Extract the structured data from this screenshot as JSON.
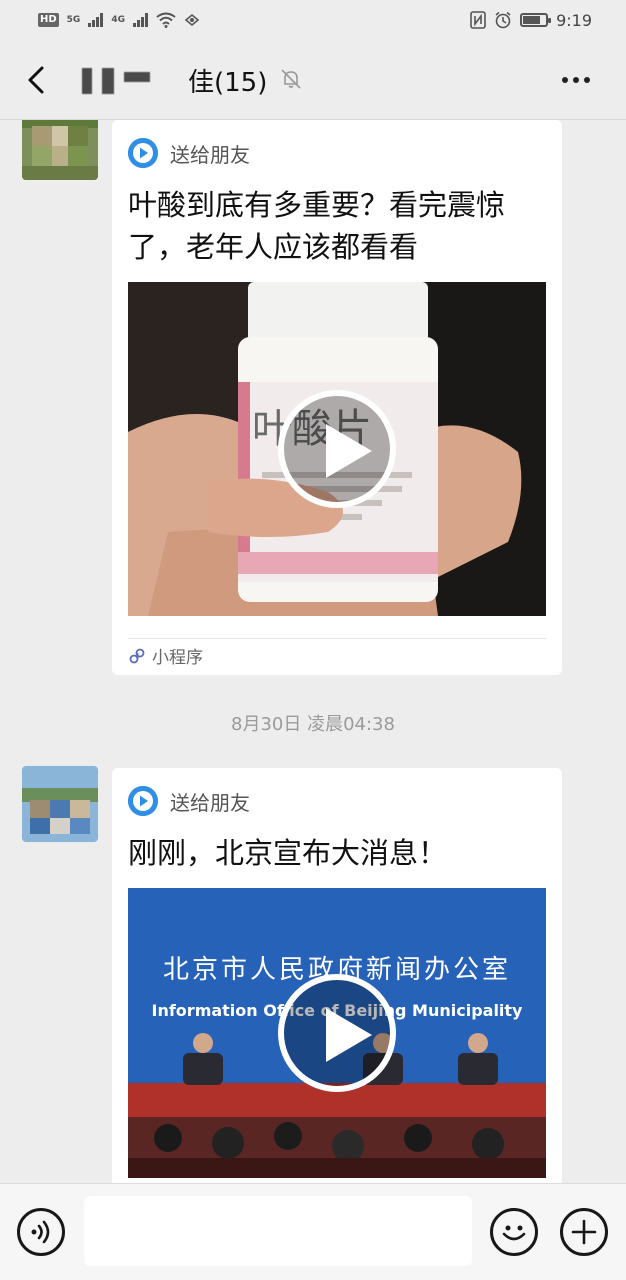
{
  "status_bar": {
    "network_badge": "HD",
    "signal_1": "5G",
    "signal_2": "4G",
    "time": "9:19"
  },
  "header": {
    "title": "佳(15)"
  },
  "messages": [
    {
      "source": "送给朋友",
      "title": "叶酸到底有多重要？看完震惊了，老年人应该都看看",
      "footer": "小程序",
      "thumbnail_label": "叶酸片"
    },
    {
      "source": "送给朋友",
      "title": "刚刚，北京宣布大消息！",
      "thumbnail_label_cn": "北京市人民政府新闻办公室",
      "thumbnail_label_en": "Information Office of Beijing Municipality"
    }
  ],
  "timestamp": "8月30日 凌晨04:38",
  "input": {
    "placeholder": ""
  }
}
